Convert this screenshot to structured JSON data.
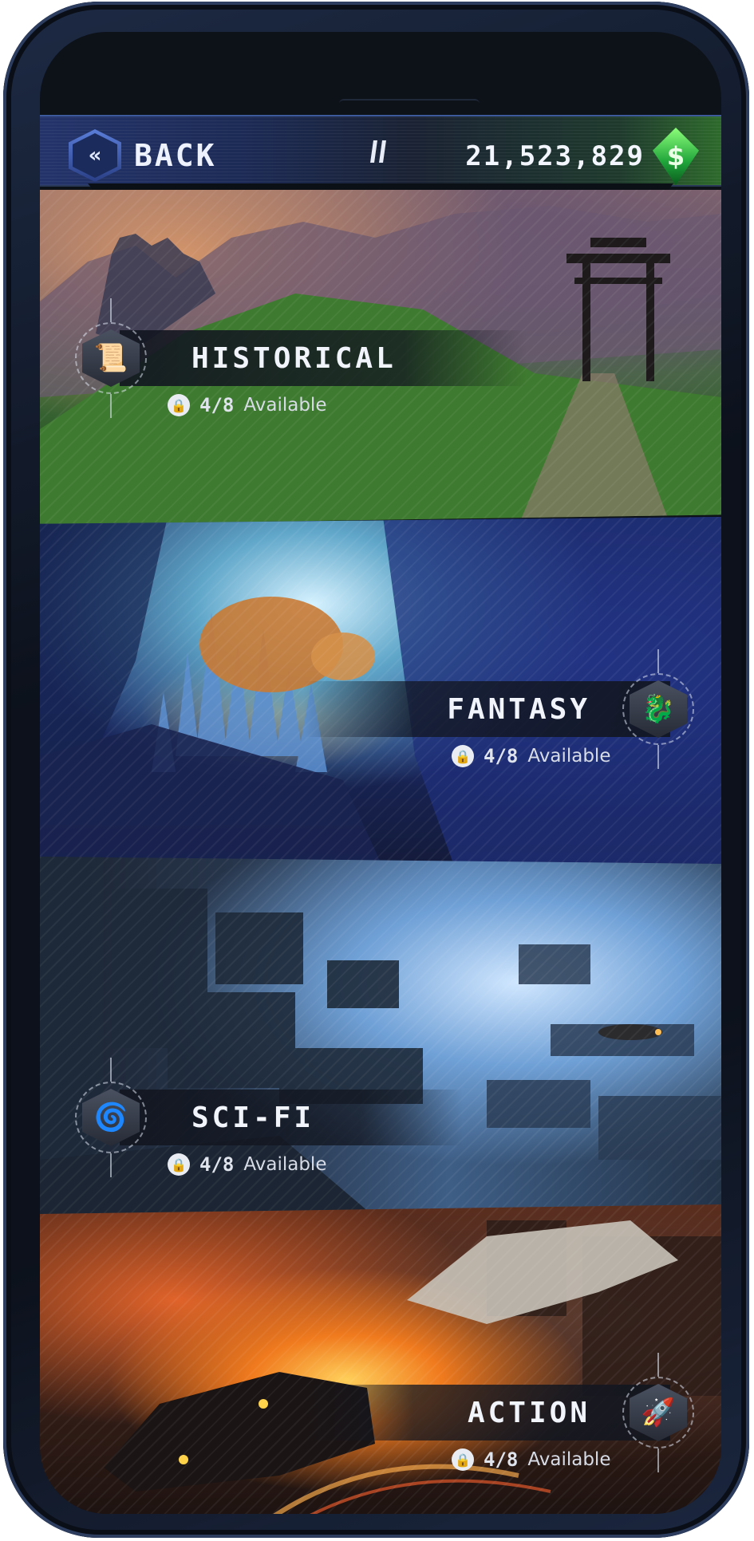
{
  "hud": {
    "back_label": "BACK",
    "back_icon": "double-chevron-left-icon",
    "pause_icon": "pause-icon",
    "currency_value": "21,523,829",
    "currency_icon": "dollar-gem-icon",
    "currency_symbol": "$"
  },
  "categories": [
    {
      "id": "historical",
      "title": "HISTORICAL",
      "count": "4/8",
      "available_word": "Available",
      "icon": "scroll-icon",
      "glyph": "📜"
    },
    {
      "id": "fantasy",
      "title": "FANTASY",
      "count": "4/8",
      "available_word": "Available",
      "icon": "dragon-icon",
      "glyph": "🐉"
    },
    {
      "id": "scifi",
      "title": "SCI-FI",
      "count": "4/8",
      "available_word": "Available",
      "icon": "galaxy-icon",
      "glyph": "🌀"
    },
    {
      "id": "action",
      "title": "ACTION",
      "count": "4/8",
      "available_word": "Available",
      "icon": "rocket-icon",
      "glyph": "🚀"
    }
  ],
  "lock_icon": "lock-icon",
  "colors": {
    "hud_left": "#24346b",
    "hud_right": "#2e6a2c",
    "gem": "#1fa43a",
    "panel": "#121620"
  }
}
